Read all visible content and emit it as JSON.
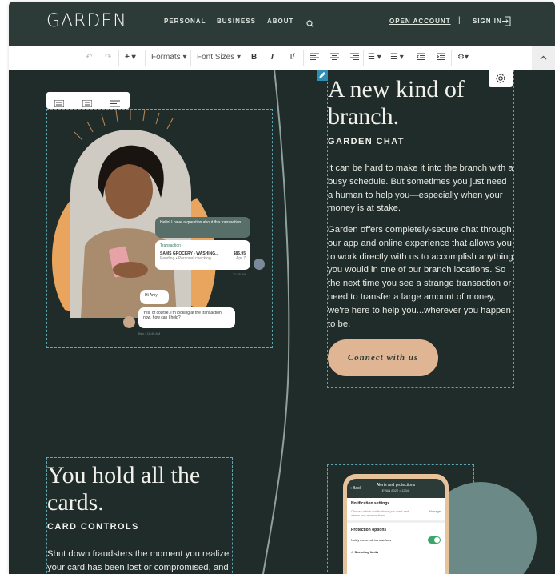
{
  "nav": {
    "logo": "GARDEN",
    "links": [
      "PERSONAL",
      "BUSINESS",
      "ABOUT"
    ],
    "open_account": "OPEN ACCOUNT",
    "divider": "|",
    "sign_in": "SIGN IN"
  },
  "toolbar": {
    "formats": "Formats",
    "font_sizes": "Font Sizes",
    "bold": "B",
    "italic": "I"
  },
  "section1": {
    "title_line1": "A new kind of",
    "title_line2": "branch.",
    "eyebrow": "GARDEN CHAT",
    "para1": "It can be hard to make it into the branch with a busy schedule. But sometimes you just need a human to help you—especially when your money is at stake.",
    "para2": "Garden offers completely-secure chat through our app and online experience that allows you to work directly with us to accomplish anything you would in one of our branch locations. So the next time you see a strange transaction or need to transfer a large amount of money, we're here to help you...wherever you happen to be.",
    "button": "Connect with us"
  },
  "chat": {
    "msg1": "Hello! I have a question about this transaction",
    "tx_label": "Transaction",
    "tx_name": "SAMS GROCERY - WASHING...",
    "tx_amount": "$86.95",
    "tx_sub": "Pending • Personal checking",
    "tx_date": "Apr 7",
    "time1": "11:38 AM",
    "msg2": "Hi Amy!",
    "msg3": "Yes, of course. I'm looking at the transaction now, how can I help?",
    "time2": "Ben • 11:40 AM"
  },
  "section2": {
    "title_line1": "You hold all the",
    "title_line2": "cards.",
    "eyebrow": "CARD CONTROLS",
    "para": "Shut down fraudsters the moment you realize your card has been lost or compromised, and"
  },
  "phone": {
    "back": "Back",
    "title": "Alerts and protections",
    "subtitle": "EVAN 8022 •(1234)",
    "notif_heading": "Notification settings",
    "notif_text": "Choose which notifications you want and where you receive them.",
    "manage": "Manage",
    "protect_heading": "Protection options",
    "notify_all": "Notify me on all transactions",
    "spending": "Spending limits"
  },
  "colors": {
    "nav_bg": "#2c3b38",
    "page_bg": "#1f2c2a",
    "button_bg": "#e0b594",
    "accent_orange": "#e9a55d",
    "dashed_outline": "#5fa6b5"
  }
}
